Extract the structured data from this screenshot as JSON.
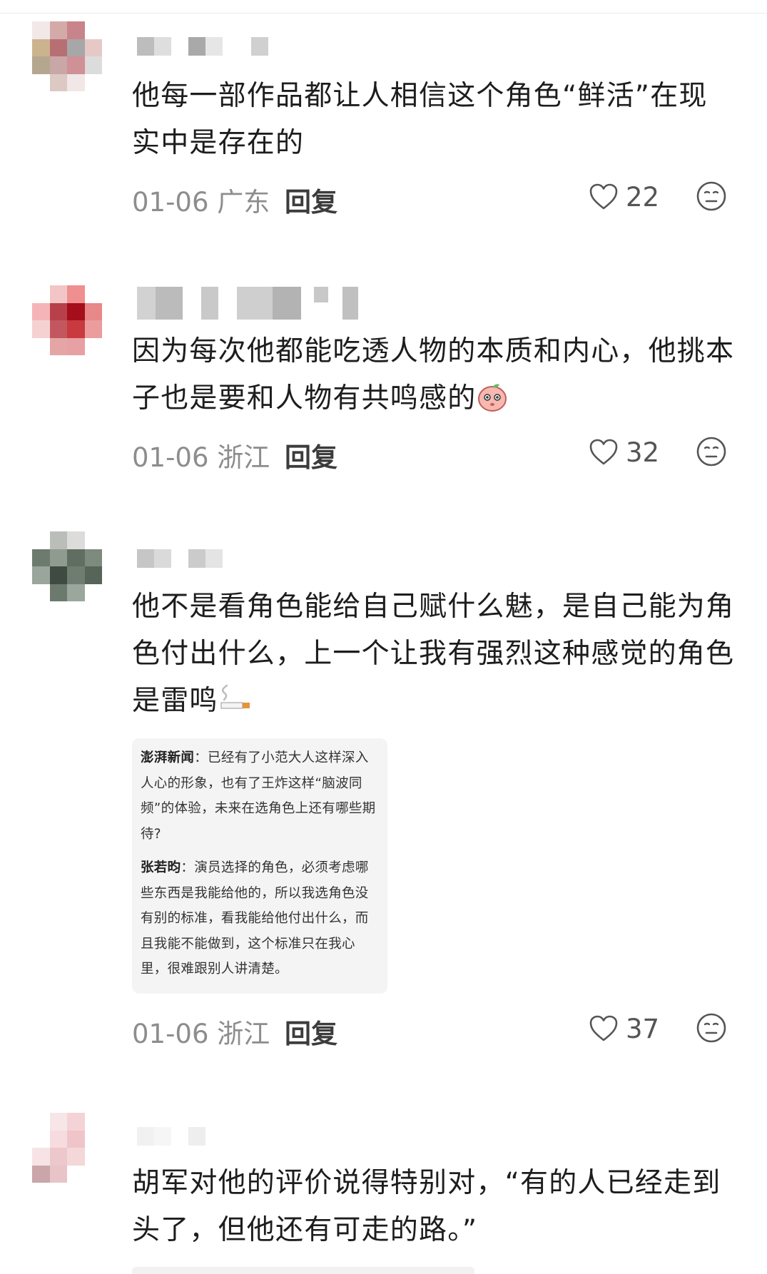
{
  "comments": [
    {
      "text": "他每一部作品都让人相信这个角色“鲜活”在现实中是存在的",
      "date": "01-06",
      "region": "广东",
      "reply_label": "回复",
      "likes": "22",
      "avatar_colors": [
        "#f2e8e8",
        "#d4aaa9",
        "#c9838a",
        "#ffffff",
        "#cbb38e",
        "#b86f74",
        "#a7a7a7",
        "#e6c9c7",
        "#b5a78f",
        "#c9a7a6",
        "#cf9096",
        "#dcdcdc",
        "#ffffff",
        "#dcc9c3",
        "#f0e7e6",
        "#ffffff"
      ]
    },
    {
      "text": "因为每次他都能吃透人物的本质和内心，他挑本子也是要和人物有共鸣感的",
      "date": "01-06",
      "region": "浙江",
      "reply_label": "回复",
      "likes": "32",
      "emoji": "peach-face-emoji",
      "avatar_colors": [
        "#ffffff",
        "#f2c6c6",
        "#f08f8f",
        "#ffffff",
        "#f5b5b8",
        "#b8404a",
        "#a40f1b",
        "#e88888",
        "#f6d1d1",
        "#c2575f",
        "#c83a3f",
        "#ec9c9c",
        "#ffffff",
        "#e5a5a5",
        "#e7a0a3",
        "#ffffff"
      ]
    },
    {
      "text": "他不是看角色能给自己赋什么魅，是自己能为角色付出什么，上一个让我有强烈这种感觉的角色是雷鸣",
      "date": "01-06",
      "region": "浙江",
      "reply_label": "回复",
      "likes": "37",
      "emoji": "cigarette-emoji",
      "avatar_colors": [
        "#ffffff",
        "#b9bfb8",
        "#dcdddb",
        "#ffffff",
        "#6d7a6e",
        "#8e9b8e",
        "#5f6e61",
        "#7d8a7e",
        "#9aa59b",
        "#3f4b42",
        "#6f7d70",
        "#56645a",
        "#ffffff",
        "#6b7a6d",
        "#9ba79c",
        "#ffffff"
      ],
      "quote": {
        "q_speaker": "澎湃新闻",
        "q_text": "已经有了小范大人这样深入人心的形象，也有了王炸这样“脑波同频”的体验，未来在选角色上还有哪些期待?",
        "a_speaker": "张若昀",
        "a_text": "演员选择的角色，必须考虑哪些东西是我能给他的，所以我选角色没有别的标准，看我能给他付出什么，而且我能不能做到，这个标准只在我心里，很难跟别人讲清楚。"
      }
    },
    {
      "text": "胡军对他的评价说得特别对，“有的人已经走到头了，但他还有可走的路。”",
      "avatar_colors": [
        "#ffffff",
        "#f7e6e8",
        "#f3d3d6",
        "#ffffff",
        "#ffffff",
        "#f6dcdf",
        "#efc5c9",
        "#ffffff",
        "#f7e3e5",
        "#ecc7cb",
        "#f4d7d9",
        "#ffffff",
        "#caa5aa",
        "#e8c4c8",
        "#ffffff",
        "#ffffff"
      ]
    }
  ],
  "colors": {
    "meta_text": "#8d8d8d",
    "reply_text": "#3c3c3c",
    "quote_bg": "#f4f4f4"
  }
}
